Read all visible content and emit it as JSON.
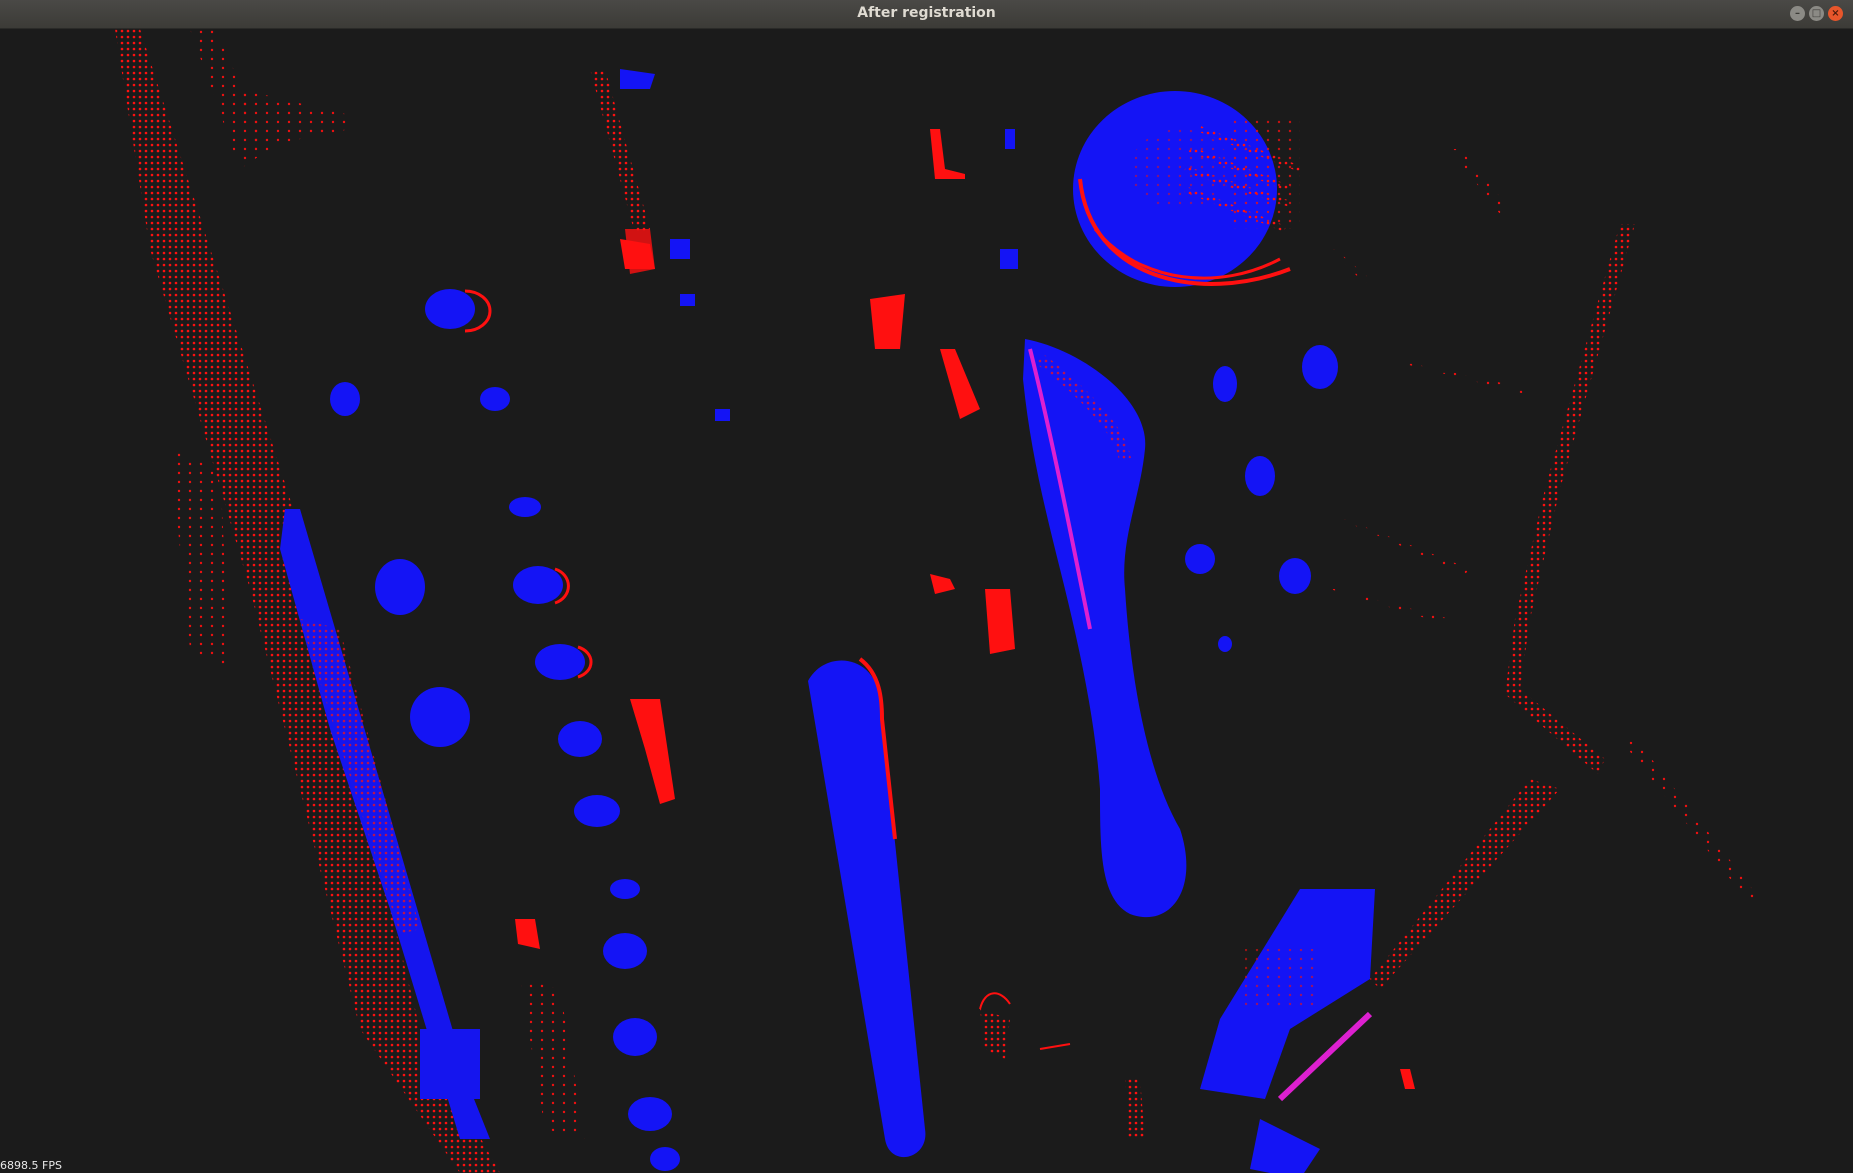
{
  "window": {
    "title": "After registration",
    "minimize_symbol": "–",
    "maximize_symbol": "□",
    "close_symbol": "×"
  },
  "viewer": {
    "fps_text": "6898.5 FPS",
    "background_color": "#1b1b1b",
    "source_cloud_color": "#ff0000",
    "target_cloud_color": "#0000ff"
  }
}
